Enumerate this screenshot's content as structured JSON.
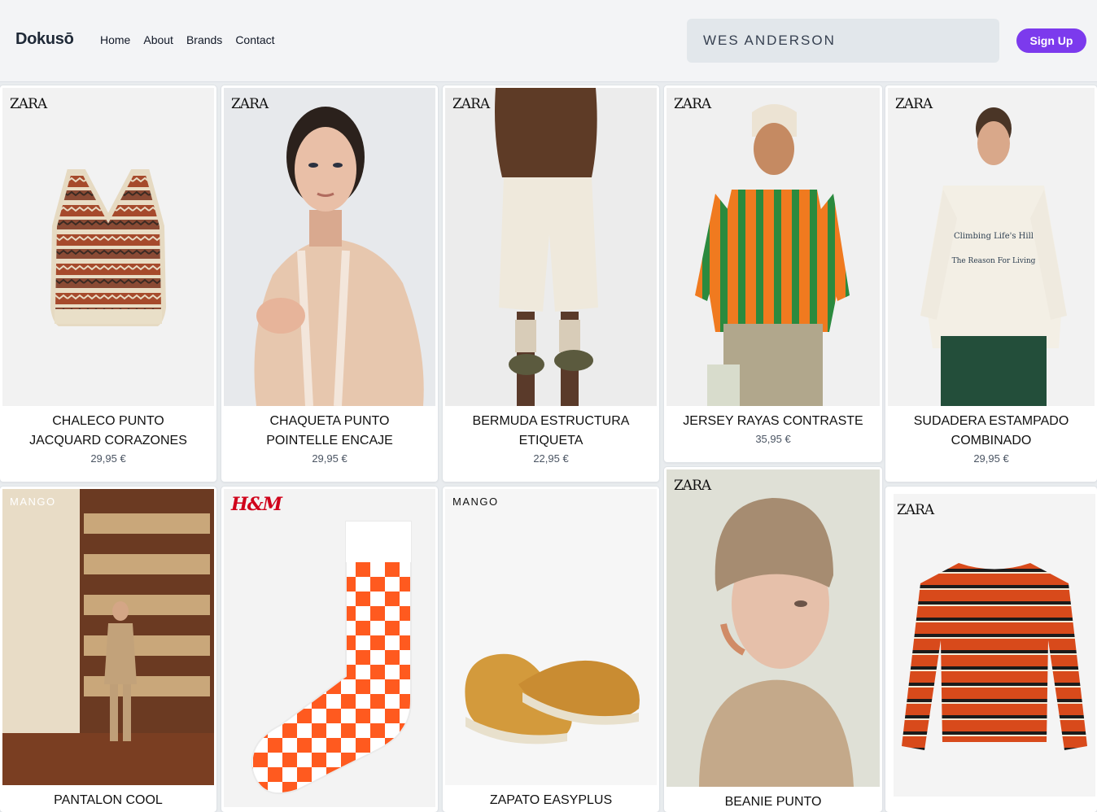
{
  "header": {
    "logo": "Dokusō",
    "nav": [
      "Home",
      "About",
      "Brands",
      "Contact"
    ],
    "search_value": "WES ANDERSON",
    "signup_label": "Sign Up"
  },
  "products": [
    {
      "brand": "ZARA",
      "title_line1": "CHALECO PUNTO",
      "title_line2": "JACQUARD CORAZONES",
      "price": "29,95 €"
    },
    {
      "brand": "ZARA",
      "title_line1": "CHAQUETA PUNTO",
      "title_line2": "POINTELLE ENCAJE",
      "price": "29,95 €"
    },
    {
      "brand": "ZARA",
      "title_line1": "BERMUDA ESTRUCTURA",
      "title_line2": "ETIQUETA",
      "price": "22,95 €"
    },
    {
      "brand": "ZARA",
      "title_line1": "JERSEY RAYAS CONTRASTE",
      "title_line2": "",
      "price": "35,95 €"
    },
    {
      "brand": "ZARA",
      "title_line1": "SUDADERA ESTAMPADO",
      "title_line2": "COMBINADO",
      "price": "29,95 €"
    },
    {
      "brand": "MANGO",
      "title_line1": "PANTALON COOL",
      "title_line2": "",
      "price": ""
    },
    {
      "brand": "H&M",
      "title_line1": "",
      "title_line2": "",
      "price": ""
    },
    {
      "brand": "MANGO",
      "title_line1": "ZAPATO EASYPLUS",
      "title_line2": "",
      "price": ""
    },
    {
      "brand": "ZARA",
      "title_line1": "BEANIE PUNTO",
      "title_line2": "",
      "price": ""
    },
    {
      "brand": "ZARA",
      "title_line1": "",
      "title_line2": "",
      "price": ""
    }
  ],
  "illustrations": {
    "p0": "knit-vest",
    "p1": "model-cardigan",
    "p2": "model-shorts",
    "p3": "model-striped-jersey",
    "p4": "model-sweatshirt",
    "p5": "model-library",
    "p6": "checkered-sock",
    "p7": "suede-loafers",
    "p8": "model-beanie",
    "p9": "striped-sweater"
  },
  "graphic_text": {
    "sweatshirt_print_line1": "Climbing Life's Hill",
    "sweatshirt_print_line2": "The Reason For Living"
  },
  "colors": {
    "accent": "#7c3aed",
    "hm_red": "#d0021b",
    "checker_orange": "#ff5a1f"
  }
}
